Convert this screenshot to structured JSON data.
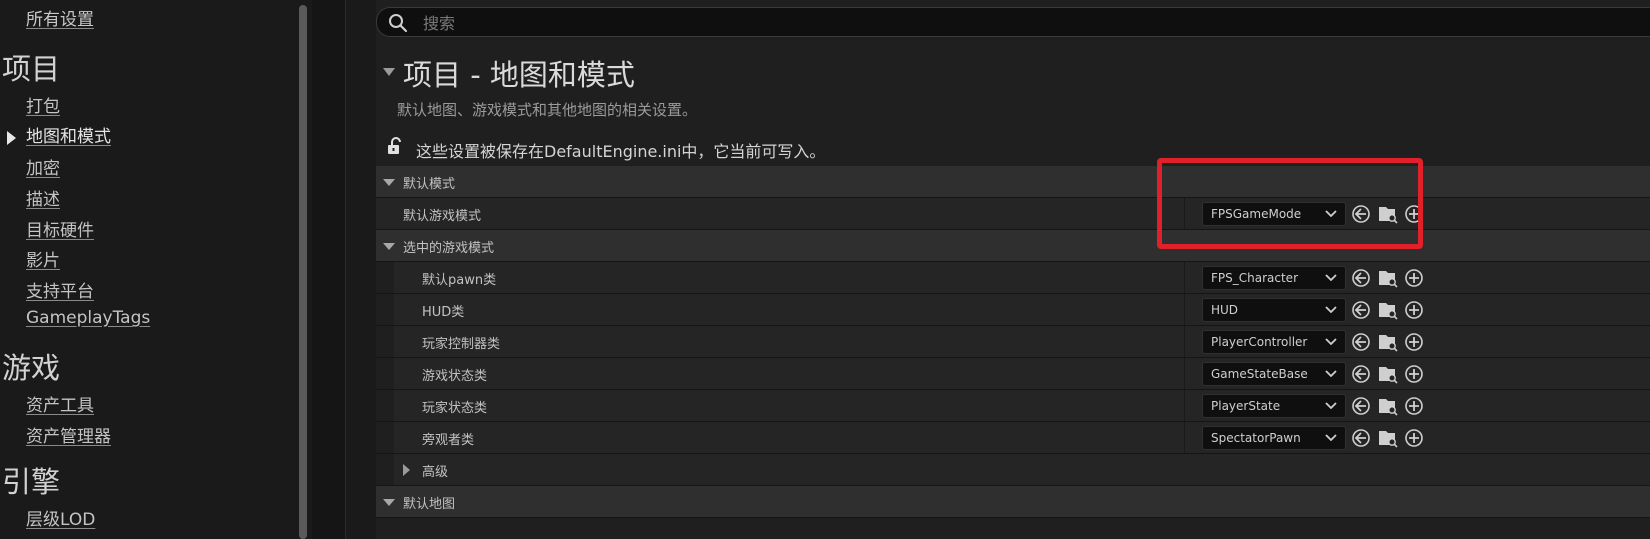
{
  "sidebar": {
    "all_settings": "所有设置",
    "sections": [
      {
        "title": "项目",
        "items": [
          "打包",
          "地图和模式",
          "加密",
          "描述",
          "目标硬件",
          "影片",
          "支持平台",
          "GameplayTags"
        ]
      },
      {
        "title": "游戏",
        "items": [
          "资产工具",
          "资产管理器"
        ]
      },
      {
        "title": "引擎",
        "items": [
          "层级LOD"
        ]
      }
    ],
    "active_item": "地图和模式"
  },
  "search": {
    "placeholder": "搜索",
    "icon": "search-icon"
  },
  "header": {
    "title": "项目 - 地图和模式",
    "description": "默认地图、游戏模式和其他地图的相关设置。",
    "save_note": "这些设置被保存在DefaultEngine.ini中，它当前可写入。",
    "lock_icon": "unlock-icon"
  },
  "categories": {
    "default_modes": "默认模式",
    "selected_game_mode": "选中的游戏模式",
    "advanced": "高级",
    "default_maps": "默认地图"
  },
  "properties": {
    "default_game_mode": {
      "label": "默认游戏模式",
      "value": "FPSGameMode"
    },
    "default_pawn": {
      "label": "默认pawn类",
      "value": "FPS_Character"
    },
    "hud": {
      "label": "HUD类",
      "value": "HUD"
    },
    "player_controller": {
      "label": "玩家控制器类",
      "value": "PlayerController"
    },
    "game_state": {
      "label": "游戏状态类",
      "value": "GameStateBase"
    },
    "player_state": {
      "label": "玩家状态类",
      "value": "PlayerState"
    },
    "spectator": {
      "label": "旁观者类",
      "value": "SpectatorPawn"
    }
  },
  "colors": {
    "highlight_box": "#e0202a",
    "background": "#1f1f1f",
    "category_row": "#2f2f2f",
    "property_row": "#252525"
  }
}
